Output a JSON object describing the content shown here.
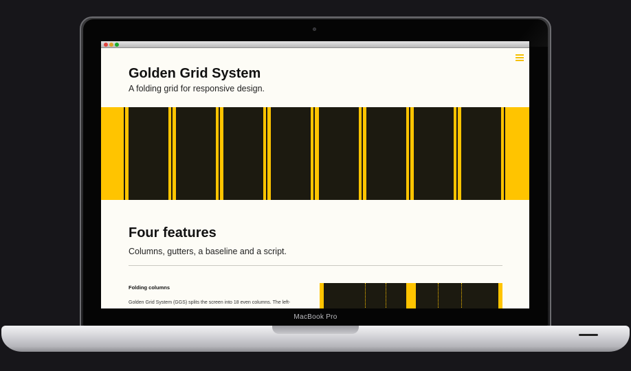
{
  "device": {
    "brand_label": "MacBook Pro"
  },
  "browser": {
    "buttons": [
      "close",
      "minimize",
      "zoom"
    ]
  },
  "site": {
    "title": "Golden Grid System",
    "tagline": "A folding grid for responsive design.",
    "menu_icon": "hamburger-menu-icon",
    "accent_color": "#ffc400",
    "column_color": "#1c1a10",
    "background_color": "#fdfcf6"
  },
  "features_section": {
    "heading": "Four features",
    "lead": "Columns, gutters, a baseline and a script.",
    "first_feature": {
      "heading": "Folding columns",
      "text": "Golden Grid System (GGS) splits the screen into 18 even columns. The left-"
    }
  }
}
